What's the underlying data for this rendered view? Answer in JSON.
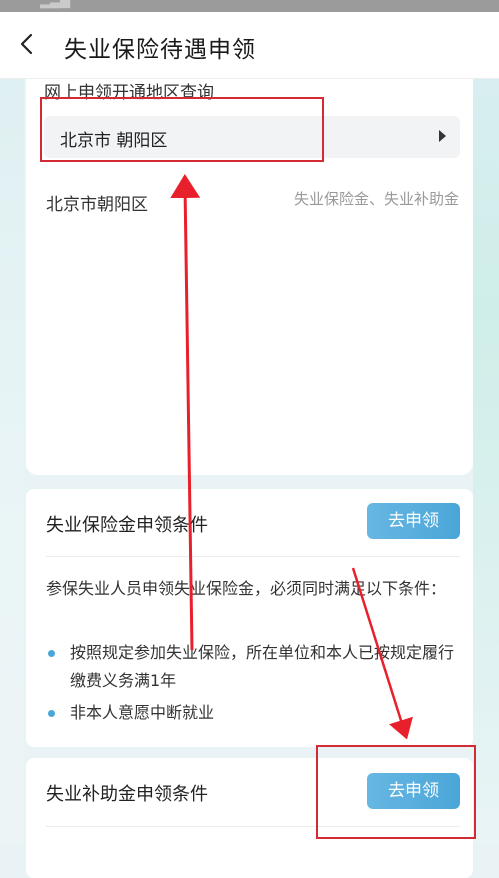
{
  "nav": {
    "title": "失业保险待遇申领"
  },
  "query": {
    "label": "网上申领开通地区查询",
    "selected_region": "北京市 朝阳区",
    "result_region": "北京市朝阳区",
    "result_benefits": "失业保险金、失业补助金"
  },
  "insurance": {
    "title": "失业保险金申领条件",
    "apply_label": "去申领",
    "intro": "参保失业人员申领失业保险金，必须同时满足以下条件：",
    "conditions": [
      "按照规定参加失业保险，所在单位和本人已按规定履行缴费义务满1年",
      "非本人意愿中断就业"
    ]
  },
  "subsidy": {
    "title": "失业补助金申领条件",
    "apply_label": "去申领"
  },
  "colors": {
    "accent": "#4aa6d8",
    "annotation": "#d42a35"
  }
}
